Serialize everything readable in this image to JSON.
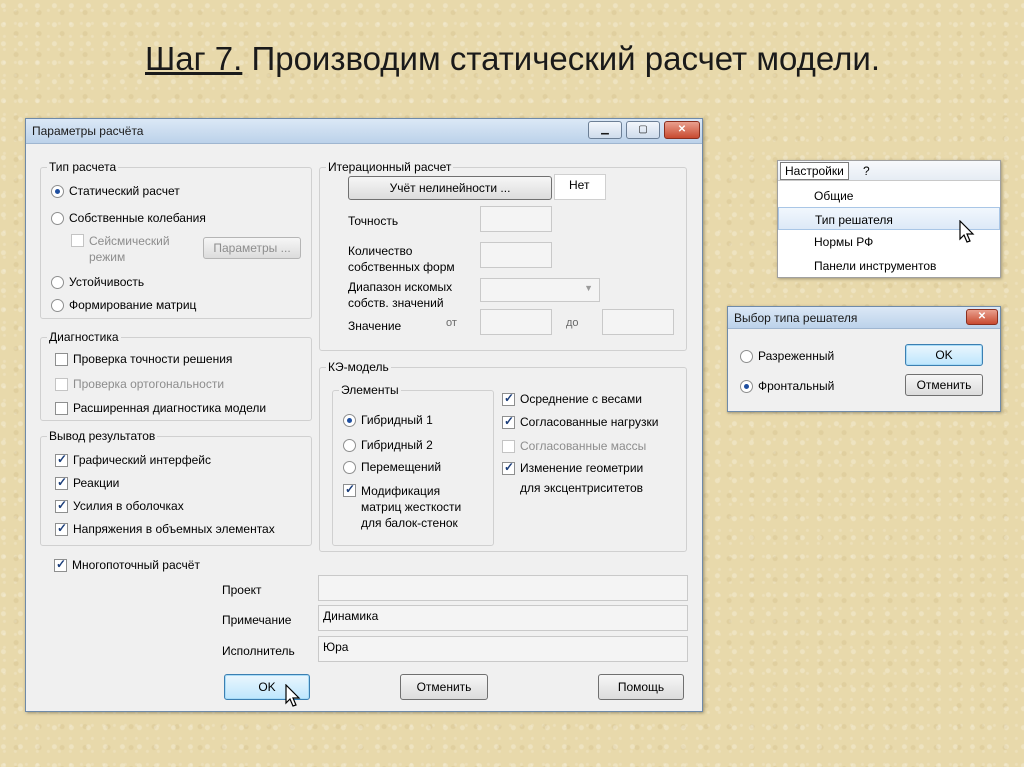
{
  "slide": {
    "title_underlined": "Шаг 7.",
    "title_rest": " Производим статический расчет модели."
  },
  "main_window": {
    "title": "Параметры расчёта",
    "calc_type": {
      "label": "Тип расчета",
      "options": [
        "Статический расчет",
        "Собственные колебания",
        "Устойчивость",
        "Формирование матриц"
      ],
      "seismic_label": "Сейсмический режим",
      "seismic_line1": "Сейсмический",
      "seismic_line2": "режим",
      "params_button": "Параметры ..."
    },
    "iteration": {
      "label": "Итерационный расчет",
      "nonlinearity_button": "Учёт нелинейности ...",
      "nonlinearity_value": "Нет",
      "accuracy": "Точность",
      "eigen_line1": "Количество",
      "eigen_line2": "собственных форм",
      "range_line1": "Диапазон искомых",
      "range_line2": "собств. значений",
      "value": "Значение",
      "from": "от",
      "to": "до"
    },
    "diagnostics": {
      "label": "Диагностика",
      "items": [
        "Проверка точности решения",
        "Проверка ортогональности",
        "Расширенная диагностика модели"
      ]
    },
    "fe_model": {
      "label": "КЭ-модель",
      "elements_label": "Элементы",
      "element_options": [
        "Гибридный 1",
        "Гибридный 2",
        "Перемещений"
      ],
      "mod_line1": "Модификация",
      "mod_line2": "матриц жесткости",
      "mod_line3": "для балок-стенок",
      "right_items": [
        "Осреднение с весами",
        "Согласованные нагрузки",
        "Согласованные массы"
      ],
      "geom_line1": "Изменение геометрии",
      "geom_line2": "для эксцентриситетов"
    },
    "output": {
      "label": "Вывод результатов",
      "items": [
        "Графический интерфейс",
        "Реакции",
        "Усилия в оболочках",
        "Напряжения в объемных элементах"
      ]
    },
    "multithread": "Многопоточный расчёт",
    "project_label": "Проект",
    "project_value": "",
    "note_label": "Примечание",
    "note_value": "Динамика",
    "author_label": "Исполнитель",
    "author_value": "Юра",
    "ok": "OK",
    "cancel": "Отменить",
    "help": "Помощь"
  },
  "menu": {
    "bar_items": [
      "Настройки",
      "?"
    ],
    "items": [
      "Общие",
      "Тип решателя",
      "Нормы РФ",
      "Панели инструментов"
    ]
  },
  "solver_window": {
    "title": "Выбор типа решателя",
    "options": [
      "Разреженный",
      "Фронтальный"
    ],
    "ok": "OK",
    "cancel": "Отменить"
  }
}
